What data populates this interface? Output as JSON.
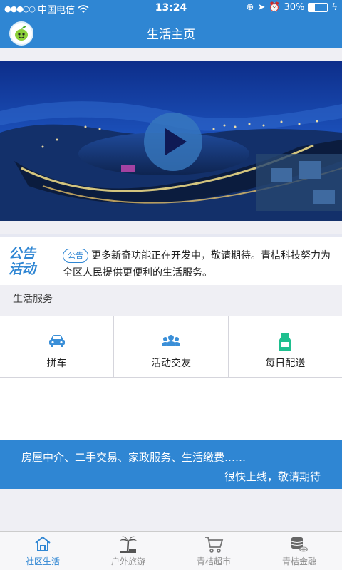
{
  "status_bar": {
    "carrier": "中国电信",
    "time": "13:24",
    "battery_percent": "30%",
    "battery_level": 0.3
  },
  "header": {
    "title": "生活主页"
  },
  "banner": {
    "play_icon": "play-icon"
  },
  "notice": {
    "title": "公告活动",
    "tag": "公告",
    "text": "更多新奇功能正在开发中，敬请期待。青桔科技努力为全区人民提供更便利的生活服务。"
  },
  "services": {
    "heading": "生活服务",
    "items": [
      {
        "label": "拼车",
        "icon": "car-icon"
      },
      {
        "label": "活动交友",
        "icon": "people-icon"
      },
      {
        "label": "每日配送",
        "icon": "milk-icon"
      }
    ]
  },
  "coming_soon": {
    "line1": "房屋中介、二手交易、家政服务、生活缴费……",
    "line2": "很快上线，敬请期待"
  },
  "tabs": [
    {
      "label": "社区生活",
      "icon": "home-icon",
      "active": true
    },
    {
      "label": "户外旅游",
      "icon": "palm-tree-icon",
      "active": false
    },
    {
      "label": "青桔超市",
      "icon": "cart-icon",
      "active": false
    },
    {
      "label": "青桔金融",
      "icon": "coins-icon",
      "active": false
    }
  ],
  "colors": {
    "primary": "#2f86d3",
    "tab_active": "#2f86d3",
    "tab_inactive": "#8a8a8a",
    "service_icon": "#3a8fd8",
    "milk_icon": "#1fbf8f"
  }
}
